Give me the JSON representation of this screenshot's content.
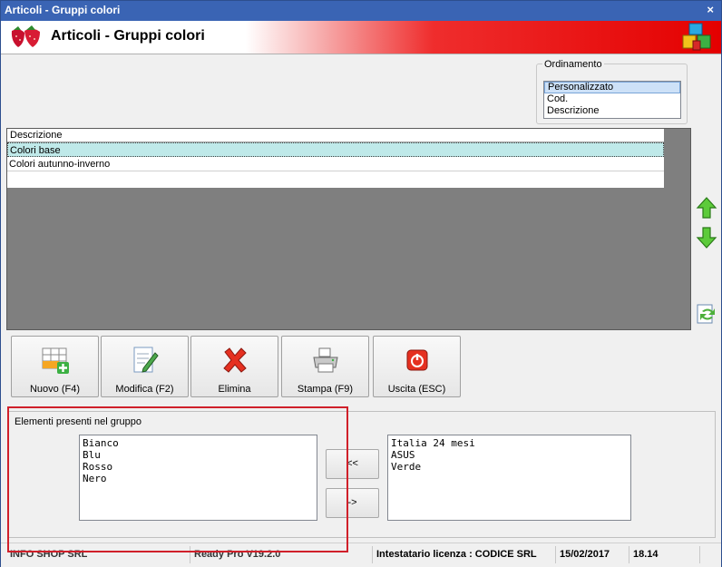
{
  "window": {
    "title": "Articoli - Gruppi colori",
    "close": "×"
  },
  "banner": {
    "title": "Articoli - Gruppi colori"
  },
  "ordinamento": {
    "label": "Ordinamento",
    "options": [
      "Personalizzato",
      "Cod.",
      "Descrizione"
    ],
    "selected": "Personalizzato"
  },
  "grid": {
    "header": "Descrizione",
    "rows": [
      "Colori base",
      "Colori autunno-inverno"
    ]
  },
  "toolbar": {
    "nuovo": "Nuovo (F4)",
    "modifica": "Modifica (F2)",
    "elimina": "Elimina",
    "stampa": "Stampa (F9)",
    "uscita": "Uscita (ESC)"
  },
  "group": {
    "label": "Elementi presenti nel gruppo",
    "in_group": [
      "Bianco",
      "Blu",
      "Rosso",
      "Nero"
    ],
    "available": [
      "Italia 24 mesi",
      "ASUS",
      "Verde"
    ],
    "add_label": "<<",
    "remove_label": "->"
  },
  "status": {
    "company": "INFO SHOP SRL",
    "version": "Ready Pro V19.2.0",
    "license": "Intestatario licenza : CODICE SRL",
    "date": "15/02/2017",
    "time": "18.14"
  },
  "colors": {
    "title_bar": "#3a64b4",
    "banner_red": "#e40000",
    "highlight_frame": "#d0202a"
  }
}
